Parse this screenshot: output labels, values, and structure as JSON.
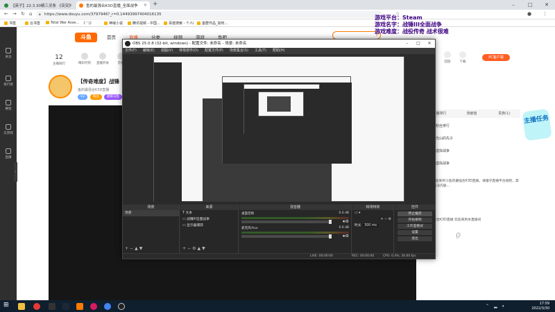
{
  "browser": {
    "tabs": [
      {
        "label": "【英子】22.3.30精三灵条 《突突》"
      },
      {
        "label": "鱼的最强合K3D直播_全面战争"
      }
    ],
    "new_tab": "+",
    "url": "https://www.douyu.com/3797946?_r=0.14493997404016135",
    "bookmarks": [
      "书签",
      "云书签",
      "Total War Asse...",
      "《 ' \\》",
      "神域小说",
      "腾讯视频 - 中国...",
      "百度搜索 - 个人l",
      "金群作品_如何..."
    ]
  },
  "douyu": {
    "logo": "斗鱼",
    "topnav": [
      "首页",
      "直播",
      "分类",
      "视频",
      "游戏",
      "鱼吧"
    ],
    "left_nav": [
      "关注",
      "排行榜",
      "赛程",
      "云游戏",
      "直播"
    ],
    "rank_number": "12",
    "rank_label": "主播排行",
    "stats": [
      "精彩时刻",
      "直播开关",
      "音频"
    ],
    "room_title": "【传奇难度】战锤",
    "room_sub": "鱼的最强合K3D直播",
    "pills": [
      "V2",
      "粉丝",
      "超级马鱼"
    ],
    "right_icons": [
      "关注",
      "回放",
      "下载",
      "联系"
    ],
    "pc_badge": "PC客户端",
    "right_tabs": [
      "主播排行",
      "贡献值",
      "贵族(1)",
      "主播排行"
    ],
    "rank_rows": [
      "粉丝排行",
      "光山的先子",
      "虚拟战争",
      "虚拟战争"
    ],
    "chat": [
      {
        "text": "欢迎来到斗鱼的最强合K3D直播，请遵守直播平台规则，禁止传播违法内容..."
      },
      {
        "text": "鱼的最强合K3D直播 欢迎来到本直播间"
      }
    ],
    "sticker": "主播任务"
  },
  "overlay": {
    "lines": [
      "游戏平台：Steam",
      "游戏名字：战锤III全面战争",
      "游戏难度：战役传奇 战术很难"
    ]
  },
  "obs": {
    "title": "OBS 25.0.8 (32-bit, windows) - 配置文件: 未命名 - 场景: 未命名",
    "menu": [
      "文件(F)",
      "编辑(E)",
      "视图(V)",
      "停靠部件(D)",
      "配置文件(P)",
      "场景集合(S)",
      "工具(T)",
      "帮助(H)"
    ],
    "docks": {
      "scenes": {
        "title": "场景",
        "items": [
          "场景"
        ]
      },
      "sources": {
        "title": "来源",
        "items": [
          "文本",
          "战锤III全面战争",
          "显示器捕获"
        ]
      },
      "mixer": {
        "title": "混音器",
        "channels": [
          {
            "name": "桌面音频",
            "db": "0.0 dB"
          },
          {
            "name": "麦克风/Aux",
            "db": "0.0 dB"
          }
        ]
      },
      "transitions": {
        "title": "转场特效",
        "duration_label": "时长",
        "duration": "300 ms"
      },
      "controls": {
        "title": "控件",
        "buttons": [
          "停止推流",
          "开始录制",
          "工作室模式",
          "设置",
          "退出"
        ]
      }
    },
    "status": {
      "live": "LIVE: 00:00:00",
      "rec": "REC: 00:00:00",
      "cpu": "CPU: 0.4%, 30.00 fps"
    }
  },
  "taskbar": {
    "time": "17:59",
    "date": "2022/3/30"
  },
  "colors": {
    "douyu_orange": "#ff5d23",
    "obs_bg": "#2b2b2b",
    "overlay_text": "#3b0080"
  }
}
